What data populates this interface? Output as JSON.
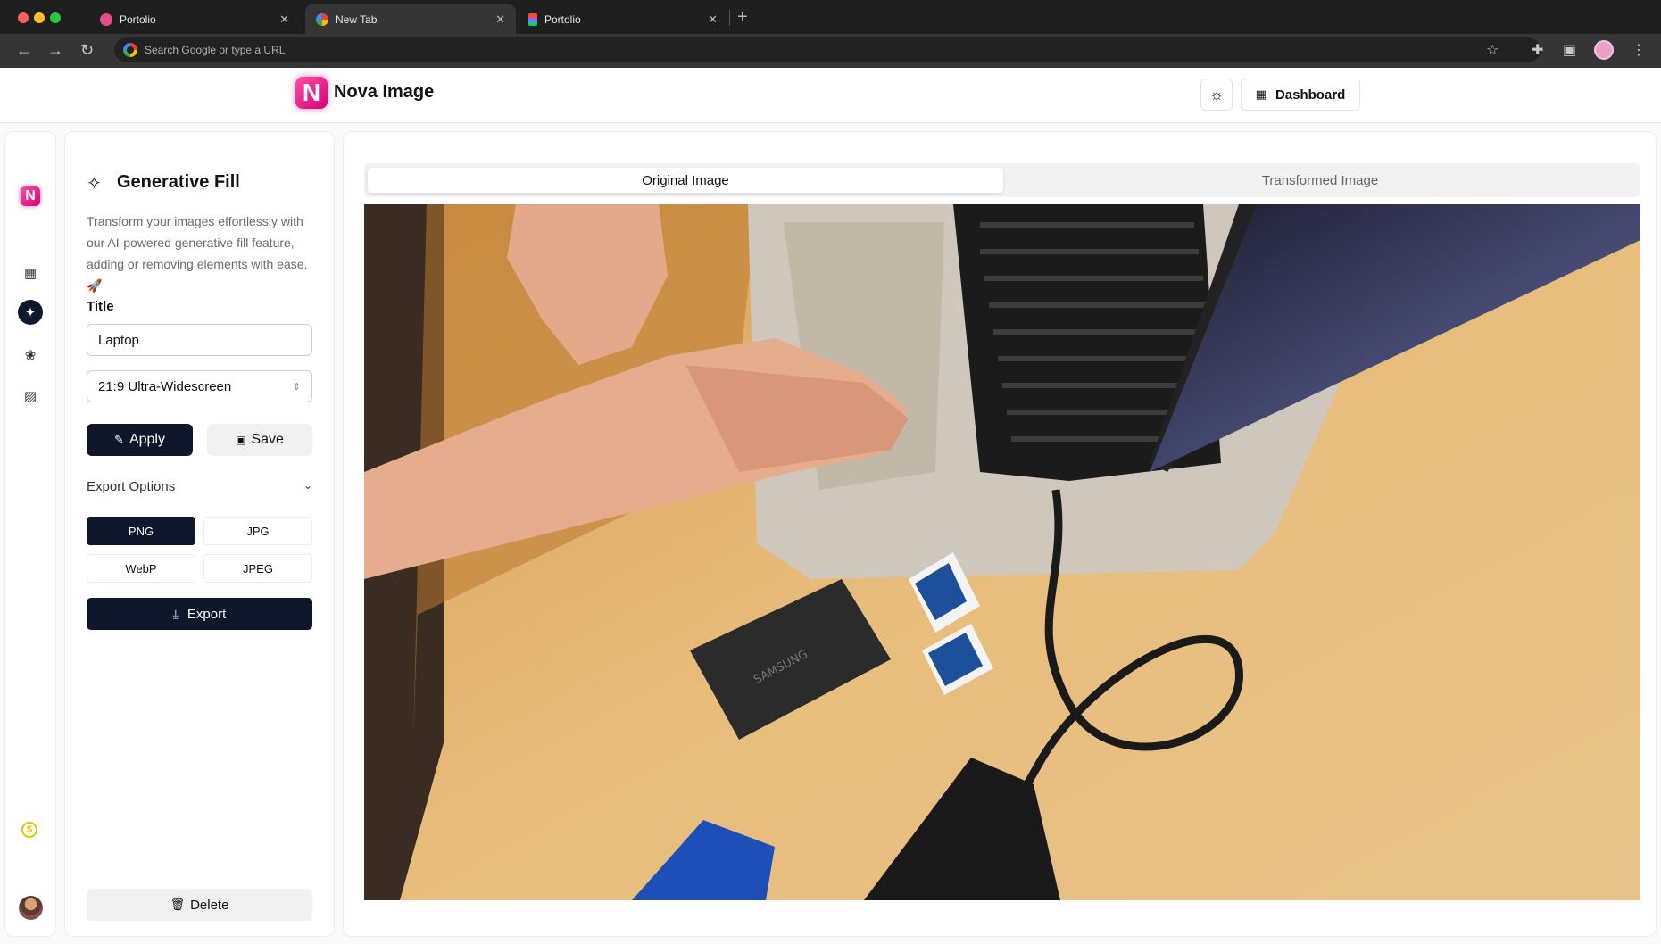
{
  "browser": {
    "tabs": [
      {
        "title": "Portolio",
        "favicon": "dribbble-icon",
        "active": false
      },
      {
        "title": "New Tab",
        "favicon": "google-icon",
        "active": true
      },
      {
        "title": "Portolio",
        "favicon": "figma-icon",
        "active": false
      }
    ],
    "omnibox_placeholder": "Search Google or type a URL"
  },
  "app": {
    "name": "Nova Image",
    "logo_letter": "N",
    "dashboard_label": "Dashboard",
    "brand_color": "#e0148a",
    "primary_color": "#0f172a"
  },
  "sidebar": {
    "items": [
      {
        "icon": "grid-icon",
        "active": false
      },
      {
        "icon": "sparkles-icon",
        "active": true
      },
      {
        "icon": "layers-icon",
        "active": false
      },
      {
        "icon": "stripes-icon",
        "active": false
      }
    ],
    "credits_icon": "coin-icon"
  },
  "panel": {
    "title": "Generative Fill",
    "description": "Transform your images effortlessly with our AI-powered generative fill feature, adding or removing elements with ease. 🚀",
    "title_label": "Title",
    "title_value": "Laptop",
    "aspect_ratio": "21:9 Ultra-Widescreen",
    "apply_label": "Apply",
    "save_label": "Save",
    "export_options_label": "Export Options",
    "formats": [
      "PNG",
      "JPG",
      "WebP",
      "JPEG"
    ],
    "selected_format": "PNG",
    "export_label": "Export",
    "delete_label": "Delete"
  },
  "main": {
    "tabs": [
      "Original Image",
      "Transformed Image"
    ],
    "active_tab": "Original Image"
  }
}
